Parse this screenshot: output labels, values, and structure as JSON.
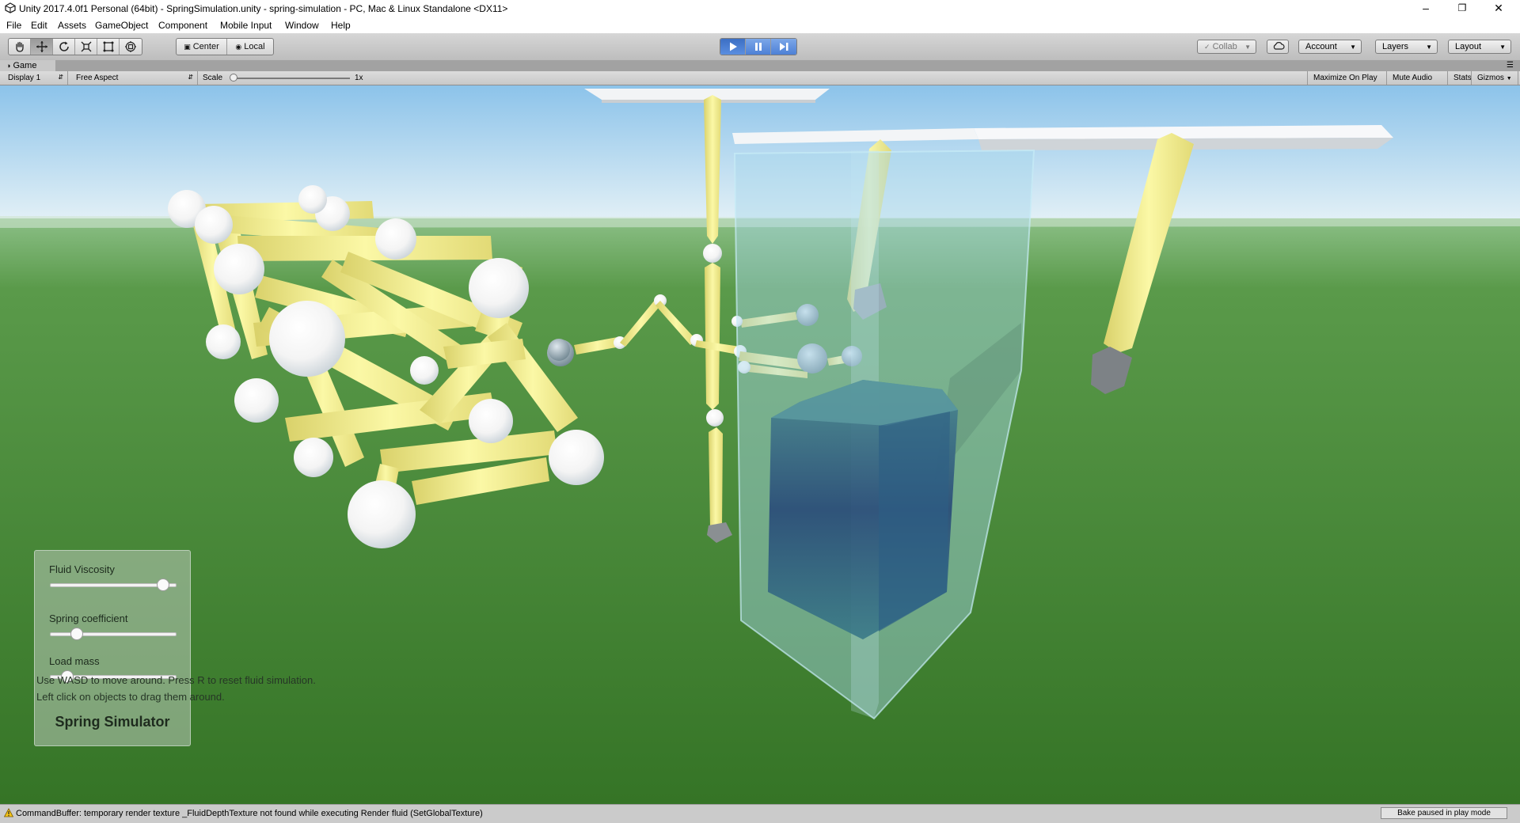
{
  "window": {
    "title": "Unity 2017.4.0f1 Personal (64bit) - SpringSimulation.unity - spring-simulation - PC, Mac & Linux Standalone <DX11>",
    "controls": [
      "minimize-icon",
      "restore-icon",
      "close-icon"
    ]
  },
  "menu": [
    "File",
    "Edit",
    "Assets",
    "GameObject",
    "Component",
    "Mobile Input",
    "Window",
    "Help"
  ],
  "toolbar": {
    "tools": [
      "hand-tool-icon",
      "move-tool-icon",
      "rotate-tool-icon",
      "scale-tool-icon",
      "rect-tool-icon",
      "transform-tool-icon"
    ],
    "pivot_mode": "Center",
    "pivot_space": "Local",
    "play_controls": [
      "play-icon",
      "pause-icon",
      "step-icon"
    ],
    "collab": "Collab",
    "account": "Account",
    "layers": "Layers",
    "layout": "Layout"
  },
  "game_view": {
    "tab": "Game",
    "display": "Display 1",
    "aspect": "Free Aspect",
    "scale_label": "Scale",
    "scale_value": "1x",
    "options": [
      "Maximize On Play",
      "Mute Audio",
      "Stats",
      "Gizmos"
    ]
  },
  "sim_panel": {
    "sliders": [
      {
        "label": "Fluid Viscosity",
        "value": 0.95
      },
      {
        "label": "Spring coefficient",
        "value": 0.18
      },
      {
        "label": "Load mass",
        "value": 0.1
      }
    ],
    "title": "Spring Simulator"
  },
  "help": {
    "line1": "Use WASD to move around. Press R to reset fluid simulation.",
    "line2": "Left click on objects to drag them around."
  },
  "status": {
    "message": "CommandBuffer: temporary render texture _FluidDepthTexture not found while executing Render fluid (SetGlobalTexture)",
    "bake": "Bake paused in play mode"
  },
  "colors": {
    "sky_top": "#8ec4ea",
    "ground": "#3e7a2c",
    "spring": "#f4f29a",
    "fluid_container": "#a8d8ec",
    "accent_play": "#3c6fc4"
  }
}
